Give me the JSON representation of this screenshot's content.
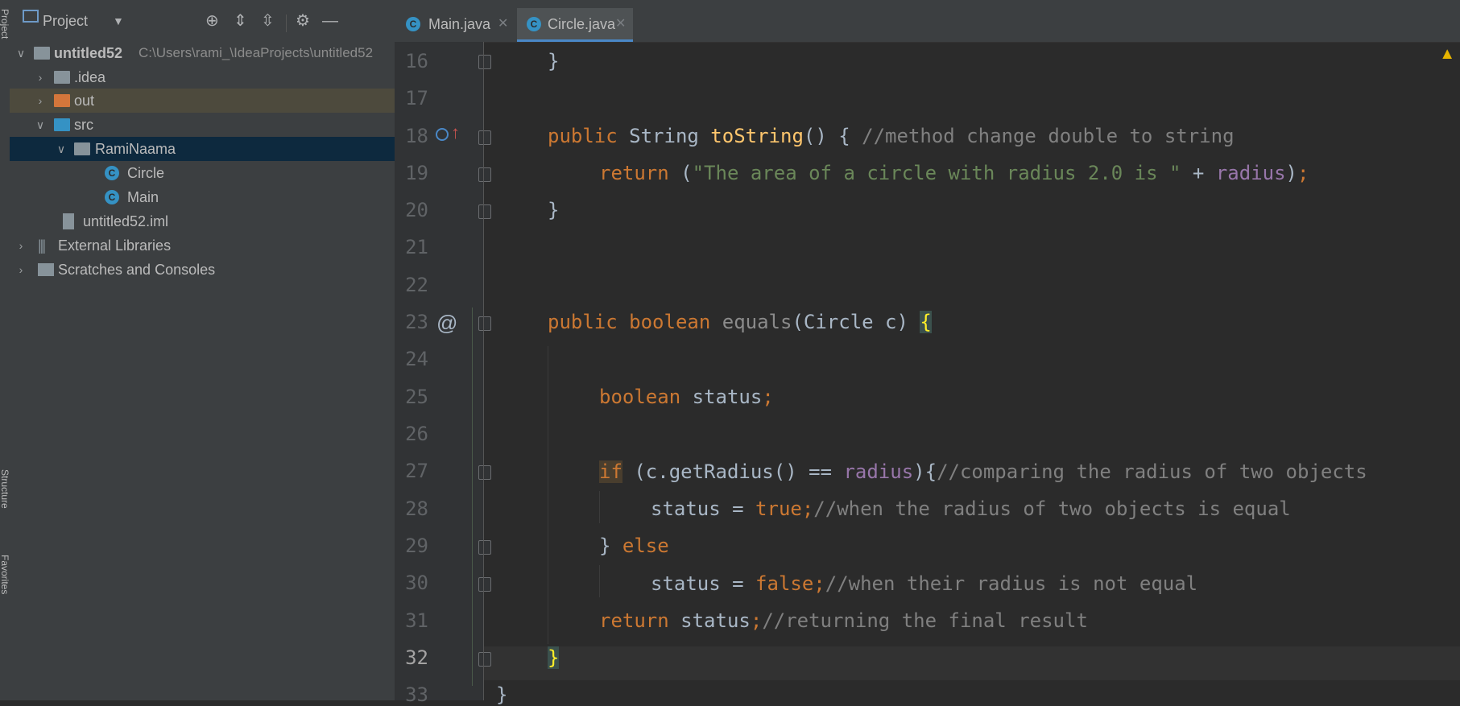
{
  "stripes": {
    "project": "Project",
    "structure": "Structure",
    "favorites": "Favorites"
  },
  "project_panel": {
    "title": "Project",
    "tree": [
      {
        "label": "untitled52",
        "path": "C:\\Users\\rami_\\IdeaProjects\\untitled52",
        "icon": "module-folder-icon",
        "expanded": true
      },
      {
        "label": ".idea",
        "icon": "folder-icon",
        "expanded": false
      },
      {
        "label": "out",
        "icon": "excluded-folder-icon",
        "expanded": false
      },
      {
        "label": "src",
        "icon": "source-folder-icon",
        "expanded": true
      },
      {
        "label": "RamiNaama",
        "icon": "package-icon",
        "expanded": true
      },
      {
        "label": "Circle",
        "icon": "class-icon"
      },
      {
        "label": "Main",
        "icon": "runnable-class-icon"
      },
      {
        "label": "untitled52.iml",
        "icon": "iml-file-icon"
      },
      {
        "label": "External Libraries",
        "icon": "libraries-icon",
        "expanded": false
      },
      {
        "label": "Scratches and Consoles",
        "icon": "scratches-icon",
        "expanded": false
      }
    ]
  },
  "editor": {
    "tabs": [
      {
        "label": "Main.java",
        "icon": "runnable-class-icon",
        "active": false
      },
      {
        "label": "Circle.java",
        "icon": "class-icon",
        "active": true
      }
    ],
    "line_numbers": [
      "16",
      "17",
      "18",
      "19",
      "20",
      "21",
      "22",
      "23",
      "24",
      "25",
      "26",
      "27",
      "28",
      "29",
      "30",
      "31",
      "32",
      "33"
    ],
    "current_line": "32",
    "code": {
      "l16": "}",
      "l18_kw": "public",
      "l18_type": " String ",
      "l18_fn": "toString",
      "l18_rest": "() { ",
      "l18_cm": "//method change double to string",
      "l19_kw": "return",
      "l19_p1": " (",
      "l19_str": "\"The area of a circle with radius 2.0 is \"",
      "l19_p2": " + ",
      "l19_fld": "radius",
      "l19_p3": ")",
      "l19_semi": ";",
      "l20": "}",
      "l23_kw": "public boolean",
      "l23_fn": " equals",
      "l23_rest": "(Circle c) ",
      "l23_brace": "{",
      "l25_kw": "boolean",
      "l25_rest": " status",
      "l25_semi": ";",
      "l27_if": "if",
      "l27_rest": " (c.getRadius() == ",
      "l27_fld": "radius",
      "l27_rest2": "){",
      "l27_cm": "//comparing the radius of two objects",
      "l28_rest": "status = ",
      "l28_kw": "true;",
      "l28_cm": "//when the radius of two objects is equal",
      "l29_brace": "} ",
      "l29_kw": "else",
      "l30_rest": "status = ",
      "l30_kw": "false;",
      "l30_cm": "//when their radius is not equal",
      "l31_kw": "return",
      "l31_rest": " status",
      "l31_semi": ";",
      "l31_cm": "//returning the final result",
      "l32": "}",
      "l33": "}"
    }
  }
}
